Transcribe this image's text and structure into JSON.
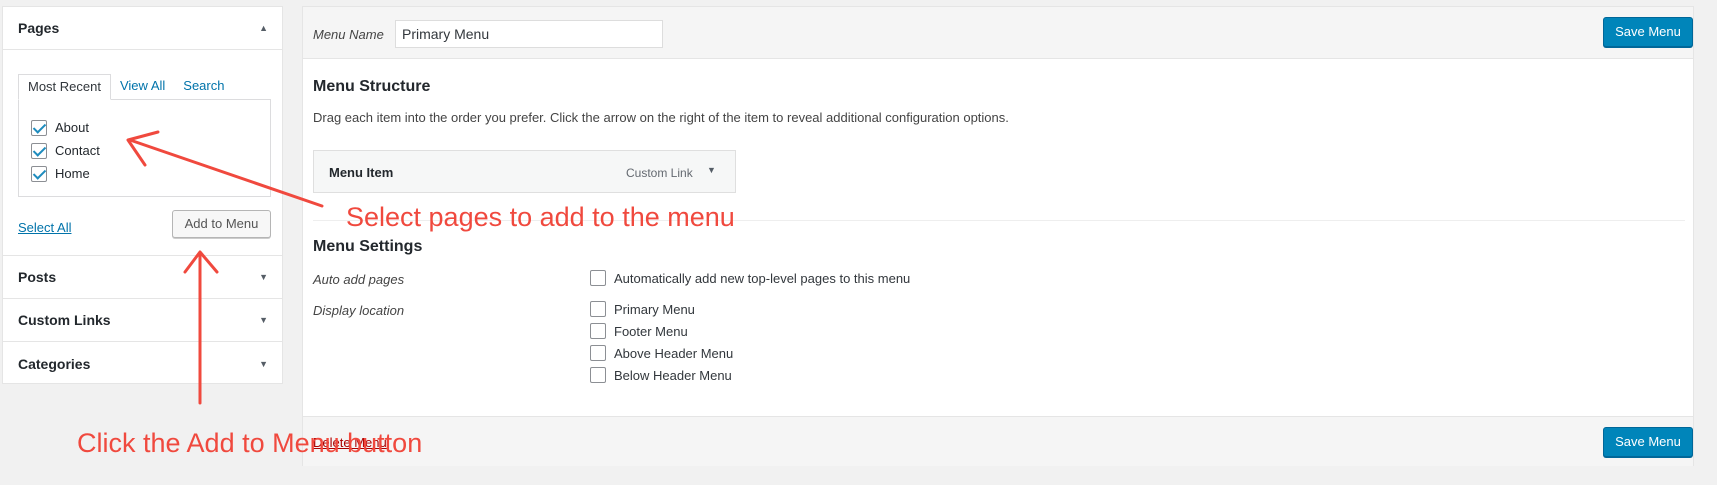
{
  "sidebar": {
    "pages": {
      "title": "Pages",
      "tabs": [
        "Most Recent",
        "View All",
        "Search"
      ],
      "items": [
        {
          "label": "About",
          "checked": true
        },
        {
          "label": "Contact",
          "checked": true
        },
        {
          "label": "Home",
          "checked": true
        }
      ],
      "select_all": "Select All",
      "add_button": "Add to Menu"
    },
    "sections": [
      {
        "title": "Posts"
      },
      {
        "title": "Custom Links"
      },
      {
        "title": "Categories"
      }
    ]
  },
  "main": {
    "menu_name_label": "Menu Name",
    "menu_name_value": "Primary Menu",
    "save_label": "Save Menu",
    "structure_title": "Menu Structure",
    "structure_desc": "Drag each item into the order you prefer. Click the arrow on the right of the item to reveal additional configuration options.",
    "menu_item": {
      "title": "Menu Item",
      "type": "Custom Link"
    },
    "settings_title": "Menu Settings",
    "auto_add_label": "Auto add pages",
    "auto_add_option": "Automatically add new top-level pages to this menu",
    "display_location_label": "Display location",
    "locations": [
      "Primary Menu",
      "Footer Menu",
      "Above Header Menu",
      "Below Header Menu"
    ],
    "delete_label": "Delete Menu"
  },
  "annotations": {
    "select_pages": "Select pages to add to the menu",
    "click_add": "Click the Add to Menu button"
  },
  "colors": {
    "accent": "#0085ba",
    "annotation": "#f0493e"
  }
}
